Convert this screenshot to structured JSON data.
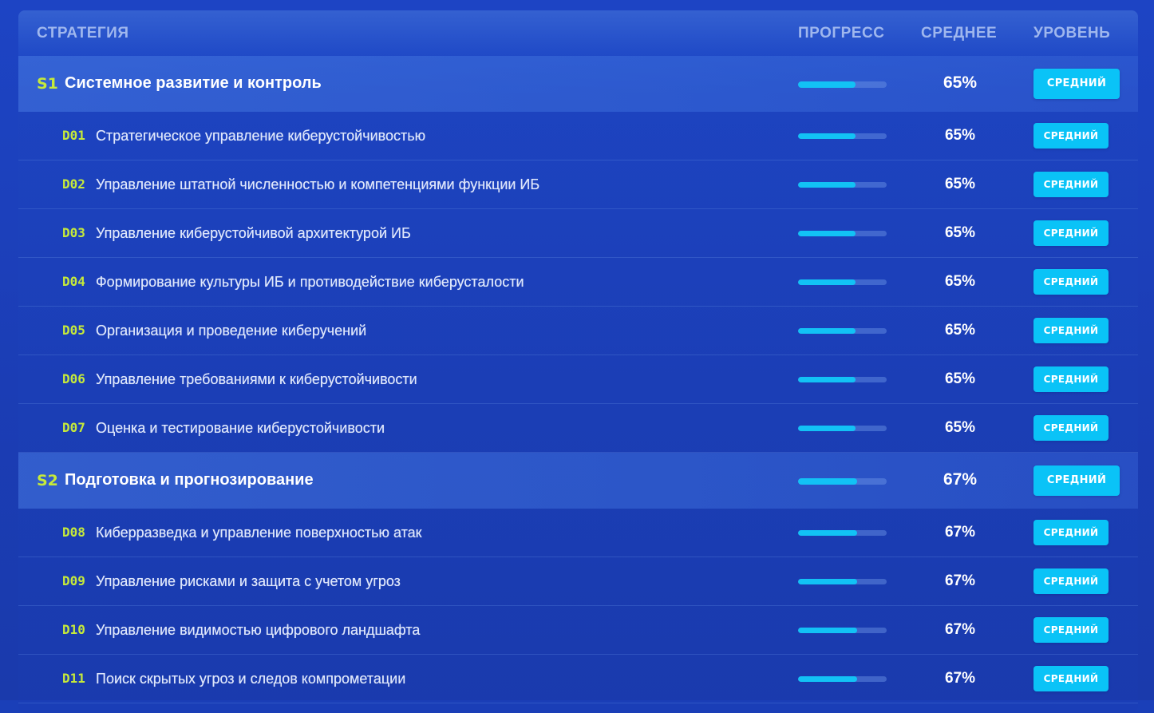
{
  "header": {
    "strategy": "СТРАТЕГИЯ",
    "progress": "ПРОГРЕСС",
    "average": "СРЕДНЕЕ",
    "level": "УРОВЕНЬ"
  },
  "colors": {
    "background": "#1a3fb8",
    "accent_code": "#c6ea3a",
    "progress_fill": "#12c2f5",
    "badge": "#0ac3f7"
  },
  "rows": [
    {
      "type": "strategy",
      "code": "S1",
      "title": "Системное развитие и контроль",
      "progress": 0.65,
      "average": "65%",
      "level": "СРЕДНИЙ"
    },
    {
      "type": "domain",
      "code": "D01",
      "title": "Стратегическое управление киберустойчивостью",
      "progress": 0.65,
      "average": "65%",
      "level": "СРЕДНИЙ"
    },
    {
      "type": "domain",
      "code": "D02",
      "title": "Управление штатной численностью и компетенциями функции ИБ",
      "progress": 0.65,
      "average": "65%",
      "level": "СРЕДНИЙ"
    },
    {
      "type": "domain",
      "code": "D03",
      "title": "Управление киберустойчивой архитектурой ИБ",
      "progress": 0.65,
      "average": "65%",
      "level": "СРЕДНИЙ"
    },
    {
      "type": "domain",
      "code": "D04",
      "title": "Формирование культуры ИБ и противодействие киберусталости",
      "progress": 0.65,
      "average": "65%",
      "level": "СРЕДНИЙ"
    },
    {
      "type": "domain",
      "code": "D05",
      "title": "Организация и проведение киберучений",
      "progress": 0.65,
      "average": "65%",
      "level": "СРЕДНИЙ"
    },
    {
      "type": "domain",
      "code": "D06",
      "title": "Управление требованиями к киберустойчивости",
      "progress": 0.65,
      "average": "65%",
      "level": "СРЕДНИЙ"
    },
    {
      "type": "domain",
      "code": "D07",
      "title": "Оценка и тестирование киберустойчивости",
      "progress": 0.65,
      "average": "65%",
      "level": "СРЕДНИЙ"
    },
    {
      "type": "strategy",
      "code": "S2",
      "title": "Подготовка и прогнозирование",
      "progress": 0.67,
      "average": "67%",
      "level": "СРЕДНИЙ"
    },
    {
      "type": "domain",
      "code": "D08",
      "title": "Киберразведка и управление поверхностью атак",
      "progress": 0.67,
      "average": "67%",
      "level": "СРЕДНИЙ"
    },
    {
      "type": "domain",
      "code": "D09",
      "title": "Управление рисками и защита с учетом угроз",
      "progress": 0.67,
      "average": "67%",
      "level": "СРЕДНИЙ"
    },
    {
      "type": "domain",
      "code": "D10",
      "title": "Управление видимостью цифрового ландшафта",
      "progress": 0.67,
      "average": "67%",
      "level": "СРЕДНИЙ"
    },
    {
      "type": "domain",
      "code": "D11",
      "title": "Поиск скрытых угроз и следов компрометации",
      "progress": 0.67,
      "average": "67%",
      "level": "СРЕДНИЙ"
    }
  ]
}
